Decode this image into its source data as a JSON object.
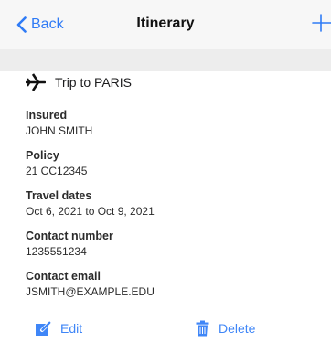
{
  "navbar": {
    "back_label": "Back",
    "title": "Itinerary",
    "back_icon": "chevron-left-icon",
    "add_icon": "plus-icon"
  },
  "trip": {
    "icon": "airplane-icon",
    "label": "Trip to PARIS"
  },
  "fields": [
    {
      "label": "Insured",
      "value": "JOHN SMITH"
    },
    {
      "label": "Policy",
      "value": "21 CC12345"
    },
    {
      "label": "Travel dates",
      "value": "Oct 6, 2021 to Oct 9, 2021"
    },
    {
      "label": "Contact number",
      "value": "1235551234"
    },
    {
      "label": "Contact email",
      "value": "JSMITH@EXAMPLE.EDU"
    }
  ],
  "actions": {
    "edit_label": "Edit",
    "delete_label": "Delete",
    "edit_icon": "pencil-icon",
    "delete_icon": "trash-icon"
  },
  "colors": {
    "accent": "#2f7bf6",
    "navbar_bg": "#f7f7f7",
    "subbar_bg": "#ededed"
  }
}
